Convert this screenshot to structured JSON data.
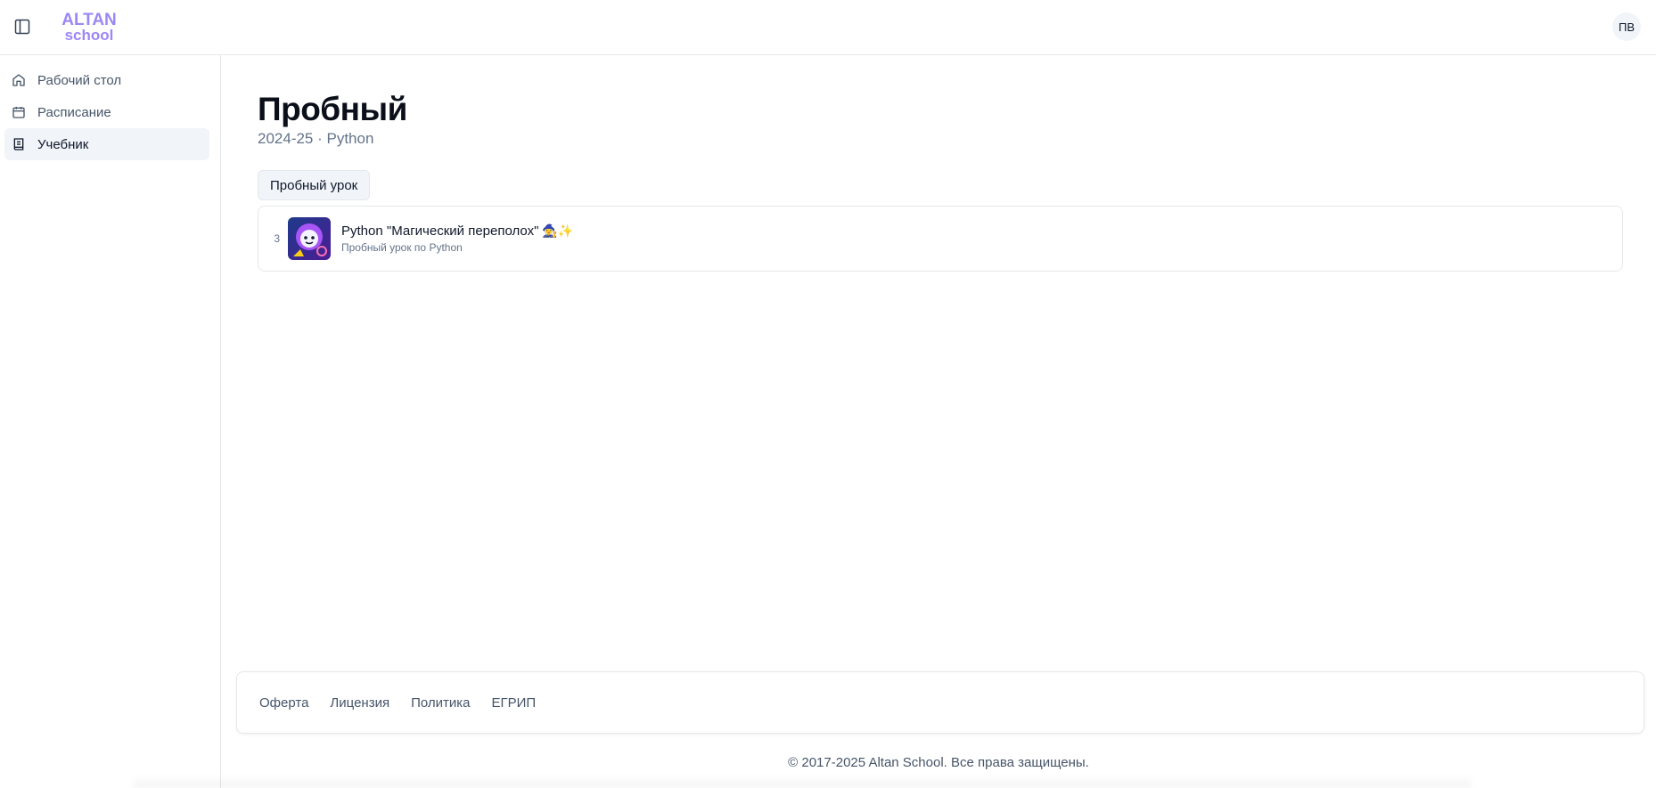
{
  "header": {
    "logo_line1": "ALTAN",
    "logo_line2": "school",
    "avatar_initials": "ПВ",
    "brand_color": "#9b87f5"
  },
  "sidebar": {
    "items": [
      {
        "label": "Рабочий стол",
        "icon": "home-icon",
        "active": false
      },
      {
        "label": "Расписание",
        "icon": "calendar-icon",
        "active": false
      },
      {
        "label": "Учебник",
        "icon": "book-icon",
        "active": true
      }
    ]
  },
  "main": {
    "title": "Пробный",
    "subtitle": "2024-25 · Python",
    "tab_label": "Пробный урок",
    "lessons": [
      {
        "number": "3",
        "title": "Python \"Магический переполох\"",
        "title_emoji": "🧙‍♀️✨",
        "description": "Пробный урок по Python"
      }
    ]
  },
  "footer": {
    "links": [
      "Оферта",
      "Лицензия",
      "Политика",
      "ЕГРИП"
    ],
    "copyright": "© 2017-2025 Altan School. Все права защищены."
  }
}
